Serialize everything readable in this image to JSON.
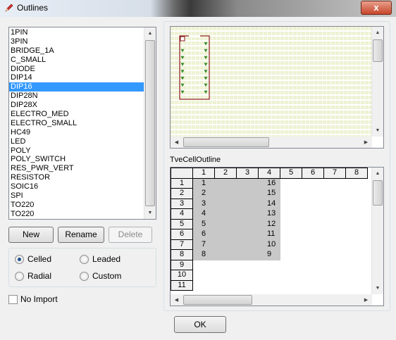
{
  "window": {
    "title": "Outlines",
    "close_glyph": "x",
    "icon": "pencil-icon"
  },
  "outline_list": {
    "items": [
      "1PIN",
      "3PIN",
      "BRIDGE_1A",
      "C_SMALL",
      "DIODE",
      "DIP14",
      "DIP16",
      "DIP28N",
      "DIP28X",
      "ELECTRO_MED",
      "ELECTRO_SMALL",
      "HC49",
      "LED",
      "POLY",
      "POLY_SWITCH",
      "RES_PWR_VERT",
      "RESISTOR",
      "SOIC16",
      "SPI",
      "TO220",
      "TO220"
    ],
    "selected": "DIP16"
  },
  "buttons": {
    "new_label": "New",
    "rename_label": "Rename",
    "delete_label": "Delete",
    "ok_label": "OK"
  },
  "outline_type": {
    "options": [
      "Celled",
      "Leaded",
      "Radial",
      "Custom"
    ],
    "selected": "Celled"
  },
  "no_import": {
    "label": "No Import",
    "checked": false
  },
  "grid": {
    "label": "TveCellOutline",
    "columns": [
      "1",
      "2",
      "3",
      "4",
      "5",
      "6",
      "7",
      "8"
    ],
    "rows": [
      "1",
      "2",
      "3",
      "4",
      "5",
      "6",
      "7",
      "8",
      "9",
      "10",
      "11"
    ],
    "left_pins": [
      "1",
      "2",
      "3",
      "4",
      "5",
      "6",
      "7",
      "8"
    ],
    "right_pins": [
      "16",
      "15",
      "14",
      "13",
      "12",
      "11",
      "10",
      "9"
    ]
  },
  "colors": {
    "selection": "#3399ff",
    "preview_stripe": "#eef2d4",
    "outline_border": "#8b1a1a",
    "pin_marker": "#3a8a2a",
    "cell_fill": "#c8c8c8"
  }
}
